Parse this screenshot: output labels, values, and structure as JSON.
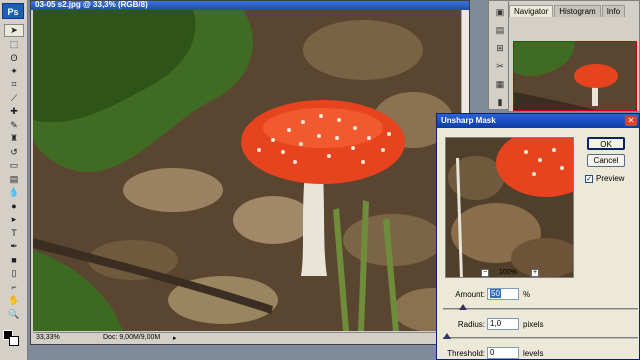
{
  "toolbox": {
    "logo": "Ps",
    "tools": [
      {
        "name": "move-tool",
        "glyph": "➤"
      },
      {
        "name": "marquee-tool",
        "glyph": "⬚"
      },
      {
        "name": "lasso-tool",
        "glyph": "ʘ"
      },
      {
        "name": "magic-wand-tool",
        "glyph": "✦"
      },
      {
        "name": "crop-tool",
        "glyph": "⌗"
      },
      {
        "name": "slice-tool",
        "glyph": "⟋"
      },
      {
        "name": "healing-brush-tool",
        "glyph": "✚"
      },
      {
        "name": "brush-tool",
        "glyph": "✎"
      },
      {
        "name": "clone-stamp-tool",
        "glyph": "♜"
      },
      {
        "name": "history-brush-tool",
        "glyph": "↺"
      },
      {
        "name": "eraser-tool",
        "glyph": "▭"
      },
      {
        "name": "gradient-tool",
        "glyph": "▤"
      },
      {
        "name": "blur-tool",
        "glyph": "💧"
      },
      {
        "name": "dodge-tool",
        "glyph": "●"
      },
      {
        "name": "path-selection-tool",
        "glyph": "▸"
      },
      {
        "name": "type-tool",
        "glyph": "T"
      },
      {
        "name": "pen-tool",
        "glyph": "✒"
      },
      {
        "name": "shape-tool",
        "glyph": "■"
      },
      {
        "name": "notes-tool",
        "glyph": "▯"
      },
      {
        "name": "eyedropper-tool",
        "glyph": "⌐"
      },
      {
        "name": "hand-tool",
        "glyph": "✋"
      },
      {
        "name": "zoom-tool",
        "glyph": "🔍"
      }
    ]
  },
  "document": {
    "title": "03-05 s2.jpg @ 33,3% (RGB/8)",
    "zoom": "33,33%",
    "doc_size": "Doc: 9,00M/9,00M"
  },
  "navigator": {
    "tabs": [
      "Navigator",
      "Histogram",
      "Info"
    ]
  },
  "dialog": {
    "title": "Unsharp Mask",
    "close_icon": "close-icon",
    "ok_label": "OK",
    "cancel_label": "Cancel",
    "preview_label": "Preview",
    "preview_checked": true,
    "zoom_level": "100%",
    "amount": {
      "label": "Amount:",
      "value": "50",
      "unit": "%",
      "slider": 0.1
    },
    "radius": {
      "label": "Radius:",
      "value": "1,0",
      "unit": "pixels",
      "slider": 0.02
    },
    "threshold": {
      "label": "Threshold:",
      "value": "0",
      "unit": "levels",
      "slider": 0.0
    }
  },
  "colors": {
    "titlebar": "#1f4ea8",
    "mushroom_cap": "#e8431f"
  }
}
